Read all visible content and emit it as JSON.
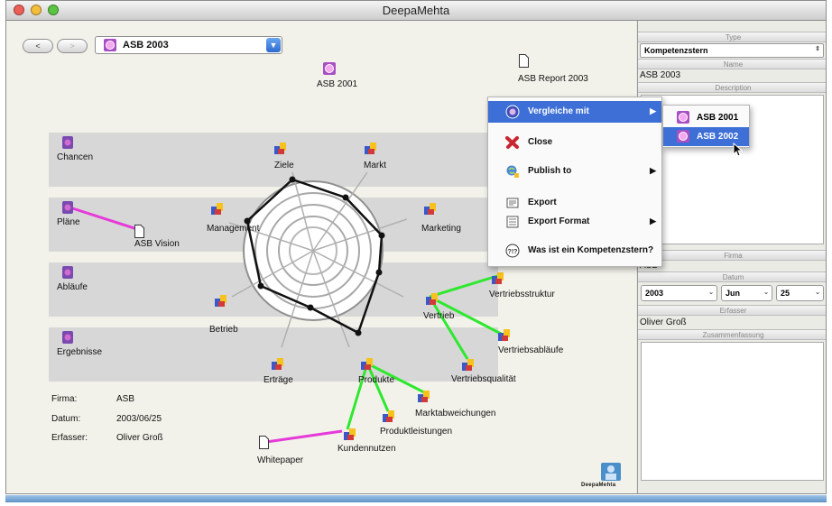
{
  "window": {
    "title": "DeepaMehta"
  },
  "toolbar": {
    "back_label": "<",
    "forward_label": ">",
    "map_select_value": "ASB 2003"
  },
  "bands": [
    {
      "label": "Chancen"
    },
    {
      "label": "Pläne"
    },
    {
      "label": "Abläufe"
    },
    {
      "label": "Ergebnisse"
    }
  ],
  "topics": {
    "asb2001": "ASB 2001",
    "asb_report": "ASB Report 2003",
    "asb_vision": "ASB Vision",
    "whitepaper": "Whitepaper"
  },
  "competences": {
    "ziele": "Ziele",
    "markt": "Markt",
    "management": "Management",
    "marketing": "Marketing",
    "betrieb": "Betrieb",
    "vertrieb": "Vertrieb",
    "ertraege": "Erträge",
    "produkte": "Produkte",
    "vertriebsstruktur": "Vertriebsstruktur",
    "vertriebsablaeufe": "Vertriebsabläufe",
    "vertriebsqualitaet": "Vertriebsqualität",
    "marktabweichungen": "Marktabweichungen",
    "produktleistungen": "Produktleistungen",
    "kundennutzen": "Kundennutzen"
  },
  "info": {
    "firma_label": "Firma:",
    "firma_value": "ASB",
    "datum_label": "Datum:",
    "datum_value": "2003/06/25",
    "erfasser_label": "Erfasser:",
    "erfasser_value": "Oliver Groß"
  },
  "logo": {
    "text": "DeepaMehta"
  },
  "context_menu": {
    "items": [
      {
        "label": "Vergleiche mit",
        "icon": "compare-icon",
        "has_submenu": true,
        "highlighted": true
      },
      {
        "label": "Close",
        "icon": "close-icon",
        "has_submenu": false
      },
      {
        "label": "Publish to",
        "icon": "publish-icon",
        "has_submenu": true
      },
      {
        "label": "Export",
        "icon": "export-icon",
        "has_submenu": false
      },
      {
        "label": "Export Format",
        "icon": "export-format-icon",
        "has_submenu": true
      },
      {
        "label": "Was ist ein Kompetenzstern?",
        "icon": "help-icon",
        "has_submenu": false
      }
    ],
    "submenu": [
      {
        "label": "ASB 2001",
        "highlighted": false
      },
      {
        "label": "ASB 2002",
        "highlighted": true
      }
    ]
  },
  "panel": {
    "type_header": "Type",
    "type_value": "Kompetenzstern",
    "name_header": "Name",
    "name_value": "ASB 2003",
    "description_header": "Description",
    "firma_header": "Firma",
    "firma_value": "ASB",
    "datum_header": "Datum",
    "date_year": "2003",
    "date_month": "Jun",
    "date_day": "25",
    "erfasser_header": "Erfasser",
    "erfasser_value": "Oliver Groß",
    "zusammenfassung_header": "Zusammenfassung"
  },
  "colors": {
    "highlight": "#3d6fd6",
    "green_link": "#2ee82e",
    "magenta_link": "#e53ad9",
    "band": "#d7d7d7"
  }
}
